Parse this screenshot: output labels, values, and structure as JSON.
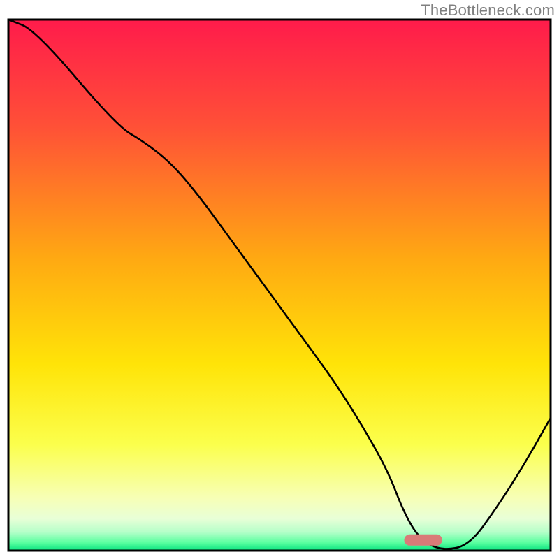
{
  "watermark": "TheBottleneck.com",
  "chart_data": {
    "type": "line",
    "title": "",
    "xlabel": "",
    "ylabel": "",
    "xlim": [
      0,
      100
    ],
    "ylim": [
      0,
      100
    ],
    "x": [
      0,
      5,
      20,
      25,
      30,
      35,
      40,
      45,
      50,
      55,
      60,
      65,
      70,
      73,
      76,
      80,
      85,
      90,
      95,
      100
    ],
    "values": [
      100,
      98,
      80,
      77,
      73,
      67,
      60,
      53,
      46,
      39,
      32,
      24,
      15,
      7,
      2,
      0,
      1,
      8,
      16,
      25
    ],
    "marker": {
      "x_start": 73,
      "x_end": 80,
      "y": 2,
      "color": "#d97b78"
    },
    "background_gradient": {
      "stops": [
        {
          "offset": 0.0,
          "color": "#ff1b4b"
        },
        {
          "offset": 0.2,
          "color": "#ff5037"
        },
        {
          "offset": 0.45,
          "color": "#ffa912"
        },
        {
          "offset": 0.65,
          "color": "#ffe408"
        },
        {
          "offset": 0.8,
          "color": "#fbff4c"
        },
        {
          "offset": 0.9,
          "color": "#f7ffb5"
        },
        {
          "offset": 0.94,
          "color": "#e8ffd7"
        },
        {
          "offset": 0.965,
          "color": "#b5ffc9"
        },
        {
          "offset": 0.985,
          "color": "#5affa0"
        },
        {
          "offset": 1.0,
          "color": "#06e27e"
        }
      ]
    },
    "frame_color": "#000000",
    "line_color": "#000000",
    "line_width": 2.6
  }
}
